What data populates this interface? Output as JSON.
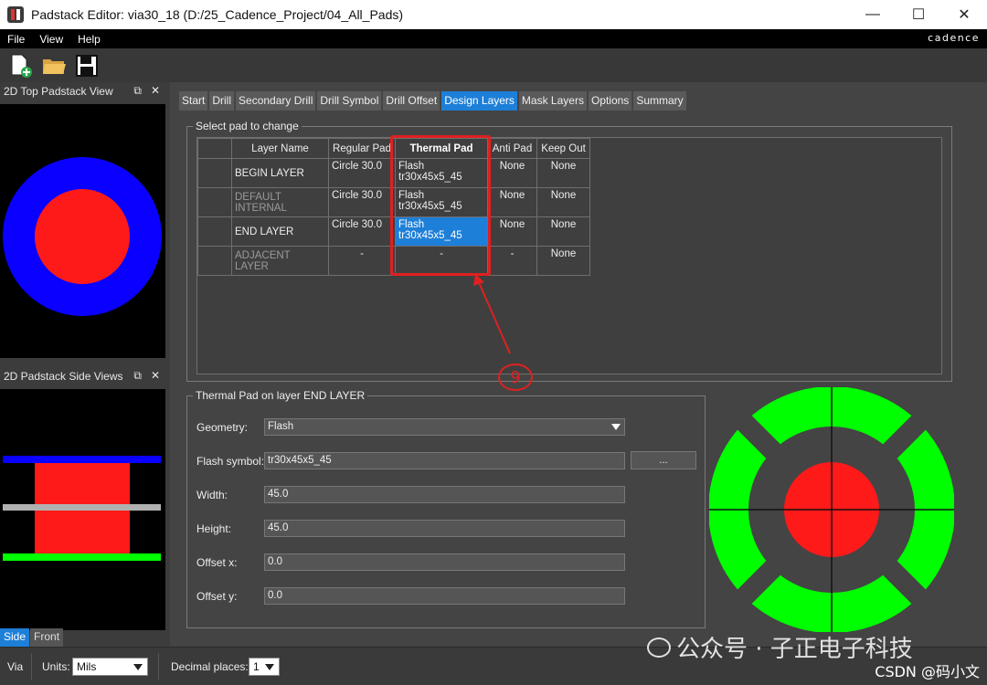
{
  "window": {
    "title": "Padstack Editor: via30_18  (D:/25_Cadence_Project/04_All_Pads)",
    "minimize": "—",
    "maximize": "☐",
    "close": "✕"
  },
  "menu": {
    "items": [
      "File",
      "View",
      "Help"
    ],
    "brand": "cadence"
  },
  "toolbar": {
    "icons": [
      "new-file-icon",
      "open-folder-icon",
      "save-icon"
    ]
  },
  "top_view": {
    "title": "2D Top Padstack View",
    "float": "⧉",
    "close": "✕"
  },
  "side_view": {
    "title": "2D Padstack Side Views",
    "float": "⧉",
    "close": "✕",
    "tabs": [
      "Side",
      "Front"
    ]
  },
  "tabs": [
    "Start",
    "Drill",
    "Secondary Drill",
    "Drill Symbol",
    "Drill Offset",
    "Design Layers",
    "Mask Layers",
    "Options",
    "Summary"
  ],
  "active_tab": "Design Layers",
  "select_group": {
    "title": "Select pad to change",
    "columns": [
      "",
      "Layer Name",
      "Regular Pad",
      "Thermal Pad",
      "Anti Pad",
      "Keep Out"
    ],
    "rows": [
      {
        "layer": "BEGIN LAYER",
        "regular": "Circle 30.0",
        "thermal": "Flash tr30x45x5_45",
        "anti": "None",
        "keep": "None"
      },
      {
        "layer": "DEFAULT INTERNAL",
        "regular": "Circle 30.0",
        "thermal": "Flash tr30x45x5_45",
        "anti": "None",
        "keep": "None"
      },
      {
        "layer": "END LAYER",
        "regular": "Circle 30.0",
        "thermal": "Flash tr30x45x5_45",
        "anti": "None",
        "keep": "None"
      },
      {
        "layer": "ADJACENT LAYER",
        "regular": "-",
        "thermal": "-",
        "anti": "-",
        "keep": "None"
      }
    ],
    "annotation": "9"
  },
  "thermal_group": {
    "title": "Thermal Pad on layer END LAYER",
    "geometry_label": "Geometry:",
    "geometry_value": "Flash",
    "flash_label": "Flash symbol:",
    "flash_value": "tr30x45x5_45",
    "browse": "...",
    "width_label": "Width:",
    "width_value": "45.0",
    "height_label": "Height:",
    "height_value": "45.0",
    "offx_label": "Offset x:",
    "offx_value": "0.0",
    "offy_label": "Offset y:",
    "offy_value": "0.0"
  },
  "status": {
    "via": "Via",
    "units_label": "Units:",
    "units_value": "Mils",
    "decimal_label": "Decimal places:",
    "decimal_value": "1"
  },
  "watermark": {
    "text": "公众号 · 子正电子科技",
    "csdn": "CSDN @码小文"
  },
  "colors": {
    "accent": "#1e7fd8",
    "pad_red": "#ff1a1a",
    "anti_blue": "#0a00ff",
    "thermal_green": "#00ff00",
    "callout": "#e02020"
  }
}
